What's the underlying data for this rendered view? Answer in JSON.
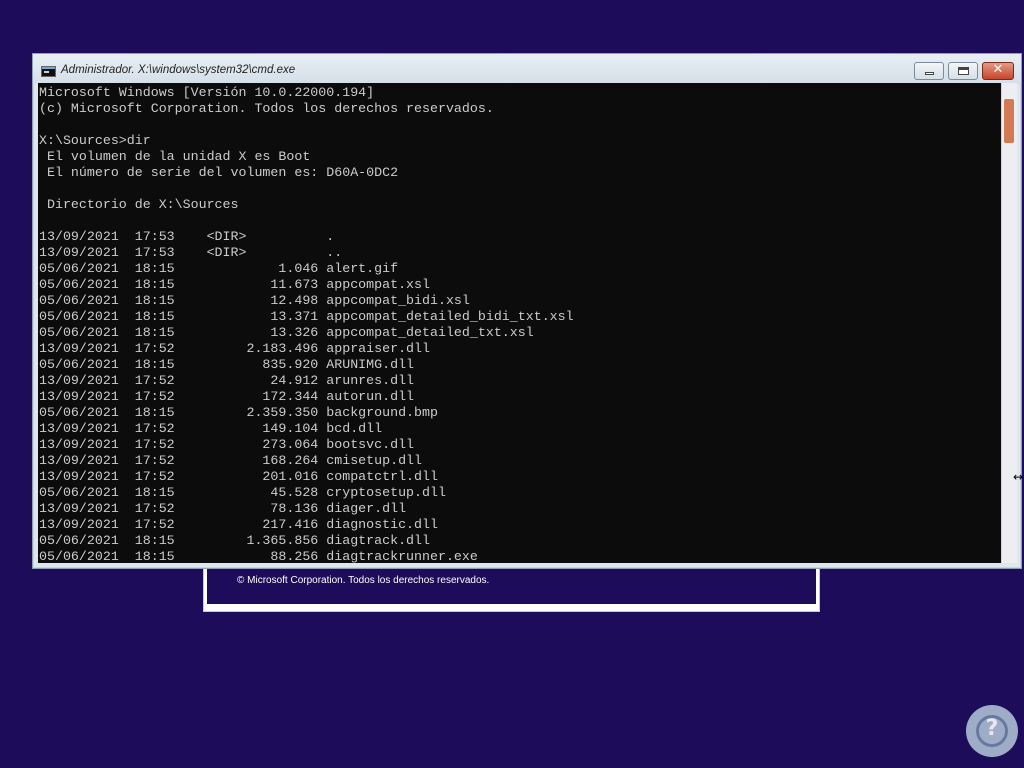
{
  "setup": {
    "copyright": "© Microsoft Corporation. Todos los derechos reservados."
  },
  "cmd": {
    "title": "Administrador. X:\\windows\\system32\\cmd.exe",
    "close_glyph": "✕",
    "icons": {
      "app": "cmd-icon",
      "minimize": "minimize-icon",
      "maximize": "maximize-icon",
      "close": "close-icon"
    },
    "output": [
      "Microsoft Windows [Versión 10.0.22000.194]",
      "(c) Microsoft Corporation. Todos los derechos reservados.",
      "",
      "X:\\Sources>dir",
      " El volumen de la unidad X es Boot",
      " El número de serie del volumen es: D60A-0DC2",
      "",
      " Directorio de X:\\Sources",
      "",
      "13/09/2021  17:53    <DIR>          .",
      "13/09/2021  17:53    <DIR>          ..",
      "05/06/2021  18:15             1.046 alert.gif",
      "05/06/2021  18:15            11.673 appcompat.xsl",
      "05/06/2021  18:15            12.498 appcompat_bidi.xsl",
      "05/06/2021  18:15            13.371 appcompat_detailed_bidi_txt.xsl",
      "05/06/2021  18:15            13.326 appcompat_detailed_txt.xsl",
      "13/09/2021  17:52         2.183.496 appraiser.dll",
      "05/06/2021  18:15           835.920 ARUNIMG.dll",
      "13/09/2021  17:52            24.912 arunres.dll",
      "13/09/2021  17:52           172.344 autorun.dll",
      "05/06/2021  18:15         2.359.350 background.bmp",
      "13/09/2021  17:52           149.104 bcd.dll",
      "13/09/2021  17:52           273.064 bootsvc.dll",
      "13/09/2021  17:52           168.264 cmisetup.dll",
      "13/09/2021  17:52           201.016 compatctrl.dll",
      "05/06/2021  18:15            45.528 cryptosetup.dll",
      "13/09/2021  17:52            78.136 diager.dll",
      "13/09/2021  17:52           217.416 diagnostic.dll",
      "05/06/2021  18:15         1.365.856 diagtrack.dll",
      "05/06/2021  18:15            88.256 diagtrackrunner.exe"
    ]
  },
  "cursor": "↔",
  "logo": {
    "glyph": "?",
    "icon": "help-logo-icon"
  }
}
